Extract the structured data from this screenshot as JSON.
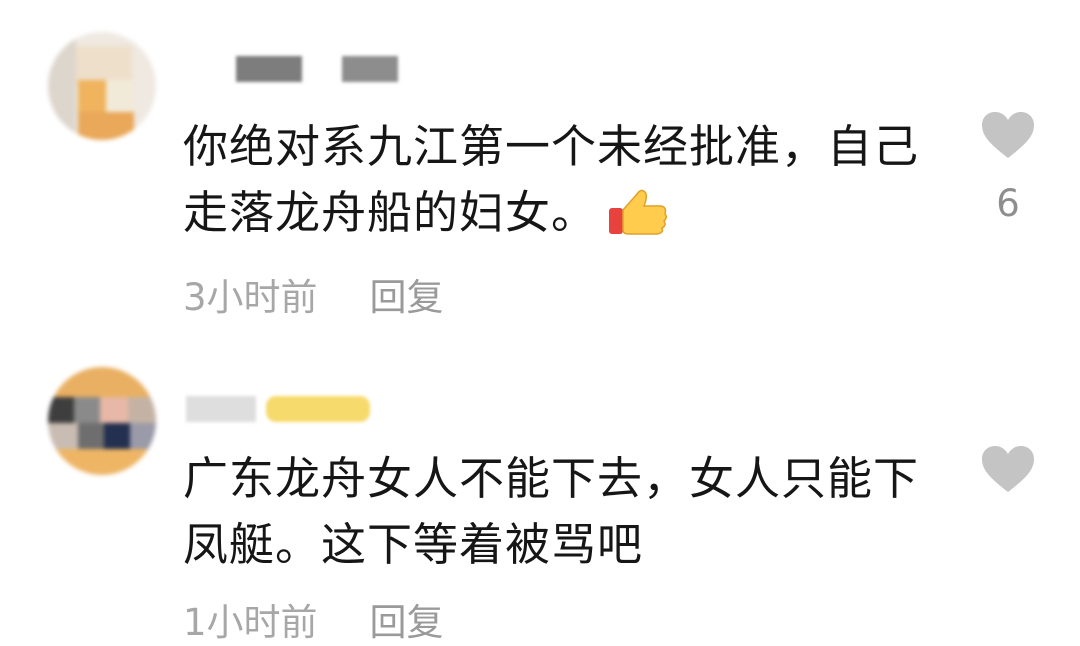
{
  "comments": [
    {
      "text": "你绝对系九江第一个未经批准，自己走落龙舟船的妇女。",
      "emoji": "thumbs-up",
      "time": "3小时前",
      "reply_label": "回复",
      "like_count": "6",
      "avatar_colors": [
        "#e9c89a",
        "#f2b468",
        "#eddcc4",
        "#d9cfc4"
      ],
      "name_blur_colors": [
        "#8a8a8a",
        "#9a9a9a"
      ]
    },
    {
      "text": "广东龙舟女人不能下去，女人只能下凤艇。这下等着被骂吧",
      "time": "1小时前",
      "reply_label": "回复",
      "like_count": "",
      "avatar_colors": [
        "#e8b35d",
        "#4a4a4a",
        "#7a7a7a",
        "#e9b0a0",
        "#2b3a5a",
        "#f0c070"
      ],
      "name_blur_colors": [
        "#d8d8d8",
        "#f6dc73"
      ]
    }
  ],
  "icons": {
    "like": "heart-icon",
    "emoji": "thumbs-up-icon"
  }
}
